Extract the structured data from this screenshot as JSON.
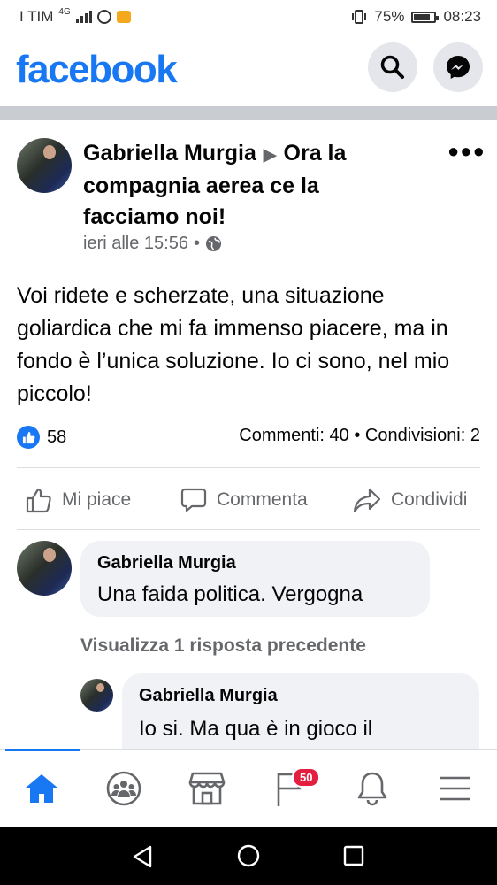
{
  "status_bar": {
    "carrier": "I TIM",
    "network": "4G",
    "battery": "75%",
    "time": "08:23"
  },
  "header": {
    "logo": "facebook",
    "search_icon": "search-icon",
    "messenger_icon": "messenger-icon"
  },
  "post": {
    "author": "Gabriella Murgia",
    "group": "Ora la compagnia aerea ce la facciamo noi!",
    "timestamp": "ieri alle 15:56",
    "separator": "•",
    "text": "Voi ridete e scherzate, una situazione goliardica che mi fa immenso piacere, ma in fondo è l’unica soluzione. Io ci sono, nel mio piccolo!",
    "reactions_count": "58",
    "comments_count": "Commenti: 40",
    "shares_count": "Condivisioni: 2",
    "counts_separator": "•"
  },
  "actions": {
    "like": "Mi piace",
    "comment": "Commenta",
    "share": "Condividi"
  },
  "comments": [
    {
      "author": "Gabriella Murgia",
      "text": "Una faida politica. Vergogna"
    },
    {
      "author": "Gabriella Murgia",
      "text": "Io si. Ma qua è in gioco il"
    }
  ],
  "view_previous_replies": "Visualizza 1 risposta precedente",
  "bottom_nav": {
    "notification_badge": "50",
    "items": [
      "home-icon",
      "groups-icon",
      "marketplace-icon",
      "pages-icon",
      "notifications-icon",
      "menu-icon"
    ]
  },
  "colors": {
    "brand": "#1877f2",
    "secondary_text": "#65676b",
    "bubble": "#f0f2f5",
    "badge": "#e41e3f"
  }
}
